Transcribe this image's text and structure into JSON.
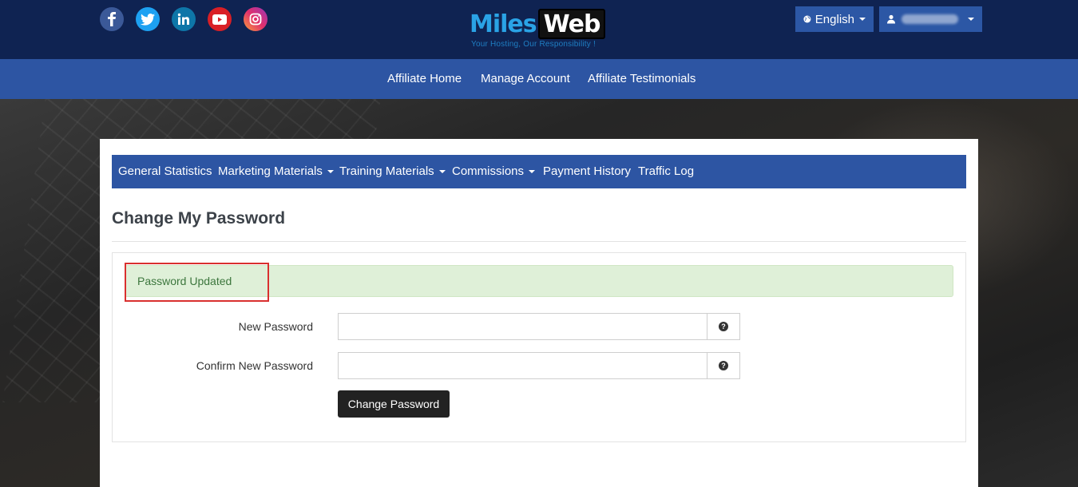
{
  "header": {
    "social": [
      {
        "name": "facebook-icon",
        "color": "#3b5998"
      },
      {
        "name": "twitter-icon",
        "color": "#1da1f2"
      },
      {
        "name": "linkedin-icon",
        "color": "#0e76a8"
      },
      {
        "name": "youtube-icon",
        "color": "#d91f26"
      },
      {
        "name": "instagram-icon",
        "color": "#e1306c"
      }
    ],
    "logo": {
      "part1": "Miles",
      "part2": "Web",
      "tagline": "Your Hosting, Our Responsibility !"
    },
    "language_label": "English"
  },
  "main_nav": [
    "Affiliate Home",
    "Manage Account",
    "Affiliate Testimonials"
  ],
  "sub_nav": [
    "General Statistics",
    "Marketing Materials",
    "Training Materials",
    "Commissions",
    "Payment History",
    "Traffic Log"
  ],
  "page": {
    "title": "Change My Password",
    "alert": "Password Updated",
    "new_password_label": "New Password",
    "confirm_password_label": "Confirm New Password",
    "new_password_value": "",
    "confirm_password_value": "",
    "submit_label": "Change Password"
  },
  "colors": {
    "topbar": "#0f2352",
    "nav": "#2d55a3",
    "alert_bg": "#dff0d8",
    "alert_text": "#3c763d",
    "highlight": "#d9302f"
  }
}
